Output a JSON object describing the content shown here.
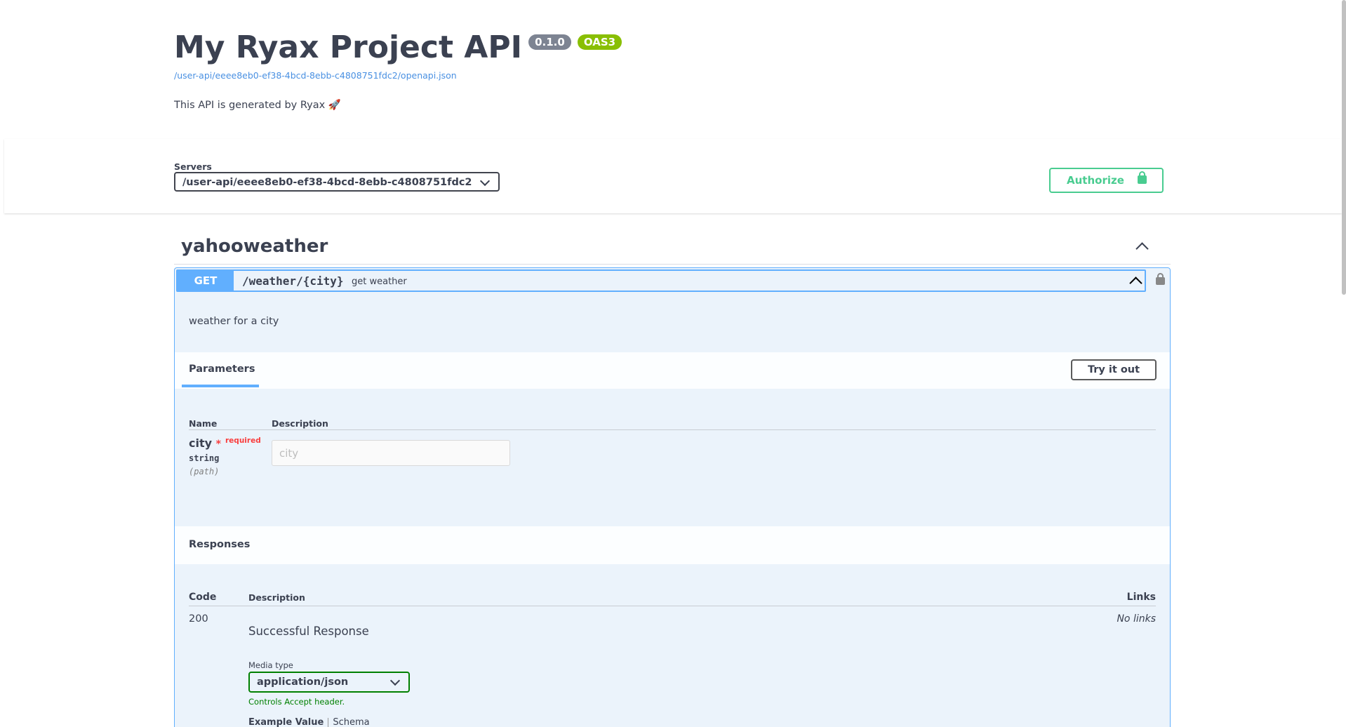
{
  "info": {
    "title": "My Ryax Project API",
    "version": "0.1.0",
    "oas": "OAS3",
    "spec_url": "/user-api/eeee8eb0-ef38-4bcd-8ebb-c4808751fdc2/openapi.json",
    "description": "This API is generated by Ryax 🚀"
  },
  "servers": {
    "label": "Servers",
    "selected": "/user-api/eeee8eb0-ef38-4bcd-8ebb-c4808751fdc2"
  },
  "authorize": {
    "label": "Authorize"
  },
  "tag": {
    "name": "yahooweather"
  },
  "operation": {
    "method": "GET",
    "path": "/weather/{city}",
    "summary": "get weather",
    "description": "weather for a city",
    "parameters_tab": "Parameters",
    "try_label": "Try it out",
    "param_headers": {
      "name": "Name",
      "description": "Description"
    },
    "param": {
      "name": "city",
      "star": "*",
      "required": "required",
      "type": "string",
      "in": "(path)",
      "placeholder": "city"
    },
    "responses": {
      "title": "Responses",
      "headers": {
        "code": "Code",
        "description": "Description",
        "links": "Links"
      },
      "code": "200",
      "description": "Successful Response",
      "links": "No links",
      "media_type_label": "Media type",
      "media_type": "application/json",
      "controls": "Controls Accept header.",
      "example_tab": "Example Value",
      "schema_tab": "Schema"
    }
  },
  "colors": {
    "get": "#61affe",
    "authorize": "#49cc90",
    "required": "#f93e3e",
    "media": "#008000"
  }
}
